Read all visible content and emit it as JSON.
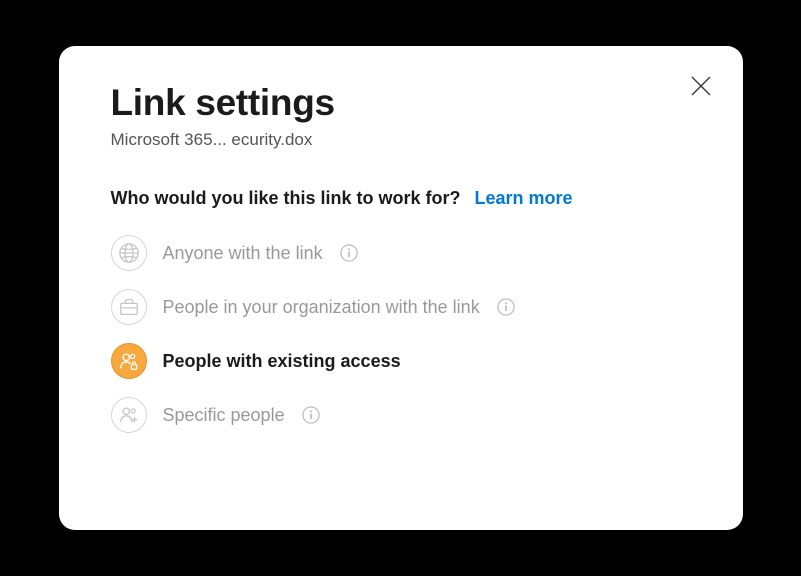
{
  "dialog": {
    "title": "Link settings",
    "subtitle": "Microsoft 365... ecurity.dox",
    "question": "Who would you like this link to work for?",
    "learn_more": "Learn more",
    "options": [
      {
        "label": "Anyone with the link",
        "selected": false,
        "has_info": true,
        "icon": "globe"
      },
      {
        "label": "People in your organization with the link",
        "selected": false,
        "has_info": true,
        "icon": "briefcase"
      },
      {
        "label": "People with existing access",
        "selected": true,
        "has_info": false,
        "icon": "people-lock"
      },
      {
        "label": "Specific people",
        "selected": false,
        "has_info": true,
        "icon": "people-plus"
      }
    ]
  }
}
